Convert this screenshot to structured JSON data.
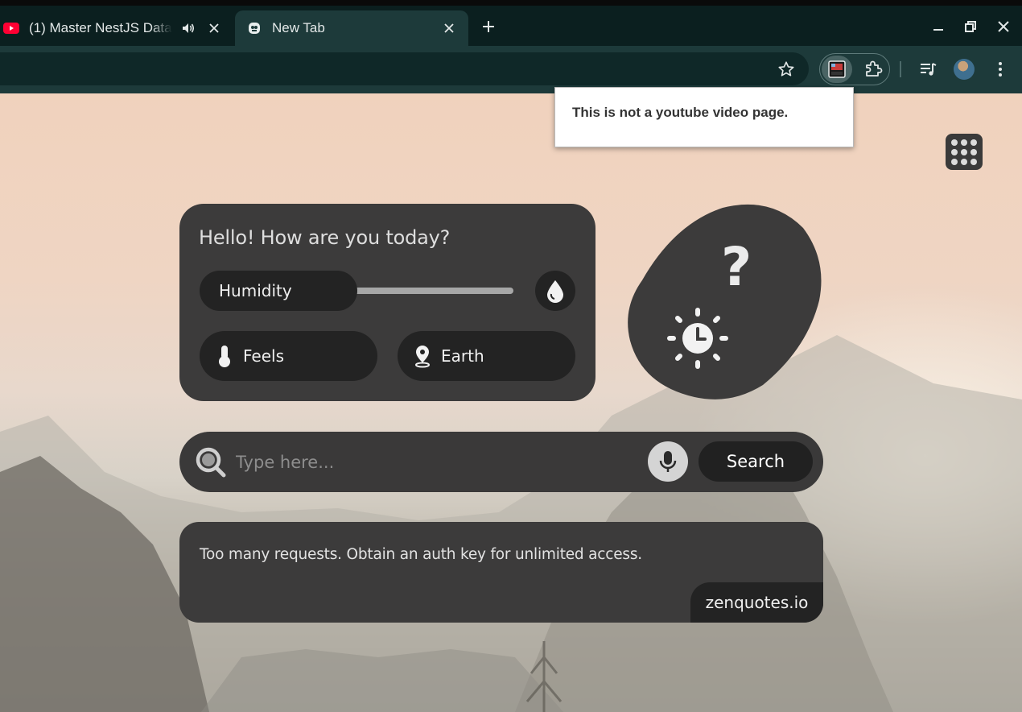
{
  "browser": {
    "tabs": [
      {
        "title": "(1) Master NestJS Data",
        "favicon": "youtube-icon",
        "audio": true
      },
      {
        "title": "New Tab",
        "favicon": "extension-favicon-icon",
        "active": true
      }
    ],
    "new_tab_icon": "plus-icon",
    "window_controls": [
      "minimize-icon",
      "restore-icon",
      "close-icon"
    ],
    "toolbar_icons": [
      "star-icon",
      "extension-active-icon",
      "puzzle-icon",
      "media-queue-icon",
      "avatar",
      "kebab-menu-icon"
    ]
  },
  "popup": {
    "message": "This is not a youtube video page."
  },
  "apps_button": {
    "icon": "apps-grid-icon"
  },
  "weather": {
    "greeting": "Hello! How are you today?",
    "humidity_label": "Humidity",
    "humidity_icon": "water-drop-icon",
    "feels_label": "Feels",
    "feels_icon": "thermometer-icon",
    "location_label": "Earth",
    "location_icon": "location-pin-icon",
    "condition_symbol": "?",
    "condition_icon": "sun-clock-icon"
  },
  "search": {
    "placeholder": "Type here...",
    "value": "",
    "button_label": "Search",
    "search_icon": "search-icon",
    "mic_icon": "microphone-icon"
  },
  "quote": {
    "text": "Too many requests. Obtain an auth key for unlimited access.",
    "author": "zenquotes.io"
  },
  "colors": {
    "chrome_dark": "#0b1f1f",
    "chrome_toolbar": "#1d3a3a",
    "card": "#3c3b3b",
    "pill": "#232323"
  }
}
